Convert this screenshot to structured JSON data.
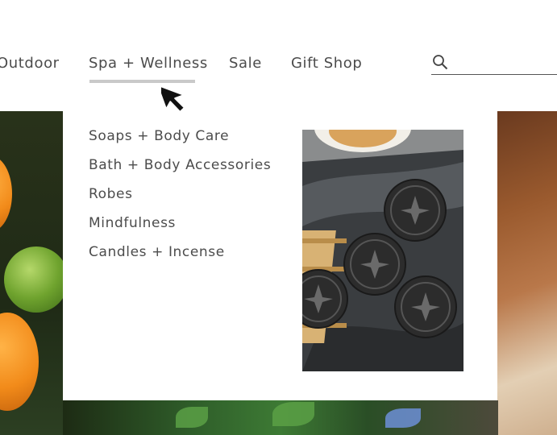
{
  "nav": {
    "items": [
      "Outdoor",
      "Spa + Wellness",
      "Sale",
      "Gift Shop"
    ],
    "active_index": 1,
    "search": {
      "placeholder": "",
      "value": ""
    }
  },
  "mega_menu": {
    "links": [
      "Soaps + Body Care",
      "Bath + Body Accessories",
      "Robes",
      "Mindfulness",
      "Candles + Incense"
    ]
  },
  "colors": {
    "nav_text": "#4b4b4b",
    "underline": "#c9c9c9",
    "menu_bg": "#ffffff",
    "top_strip": "#e4e1dc"
  },
  "icons": {
    "search": "search-icon",
    "cursor": "mouse-pointer-icon"
  }
}
